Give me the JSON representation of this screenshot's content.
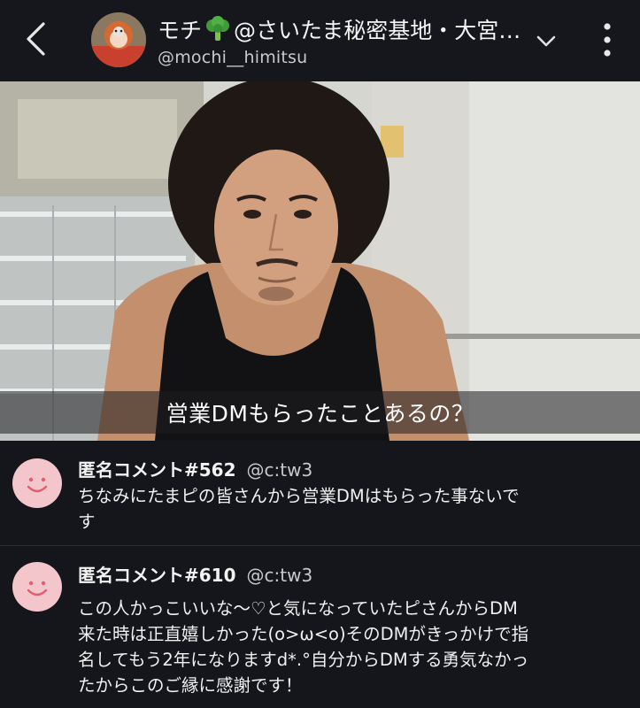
{
  "header": {
    "name_part1": "モチ",
    "name_part2": "@さいたま秘密基地・大宮…",
    "handle": "@mochi__himitsu"
  },
  "video": {
    "caption": "営業DMもらったことあるの？"
  },
  "comments": [
    {
      "title": "匿名コメント#562",
      "user": "@c:tw3",
      "text": "ちなみにたまピの皆さんから営業DMはもらった事ないで\nす"
    },
    {
      "title": "匿名コメント#610",
      "user": "@c:tw3",
      "text": "この人かっこいいな〜♡と気になっていたピさんからDM\n来た時は正直嬉しかった(o>ω<o)そのDMがきっかけで指\n名してもう2年になりますd*.°自分からDMする勇気なかっ\nたからこのご縁に感謝です！"
    }
  ],
  "colors": {
    "background": "#15161b",
    "avatar_pink": "#f3c6cb"
  },
  "icons": [
    "back-arrow-icon",
    "broccoli-icon",
    "chevron-down-icon",
    "more-vertical-icon",
    "smiley-icon"
  ]
}
